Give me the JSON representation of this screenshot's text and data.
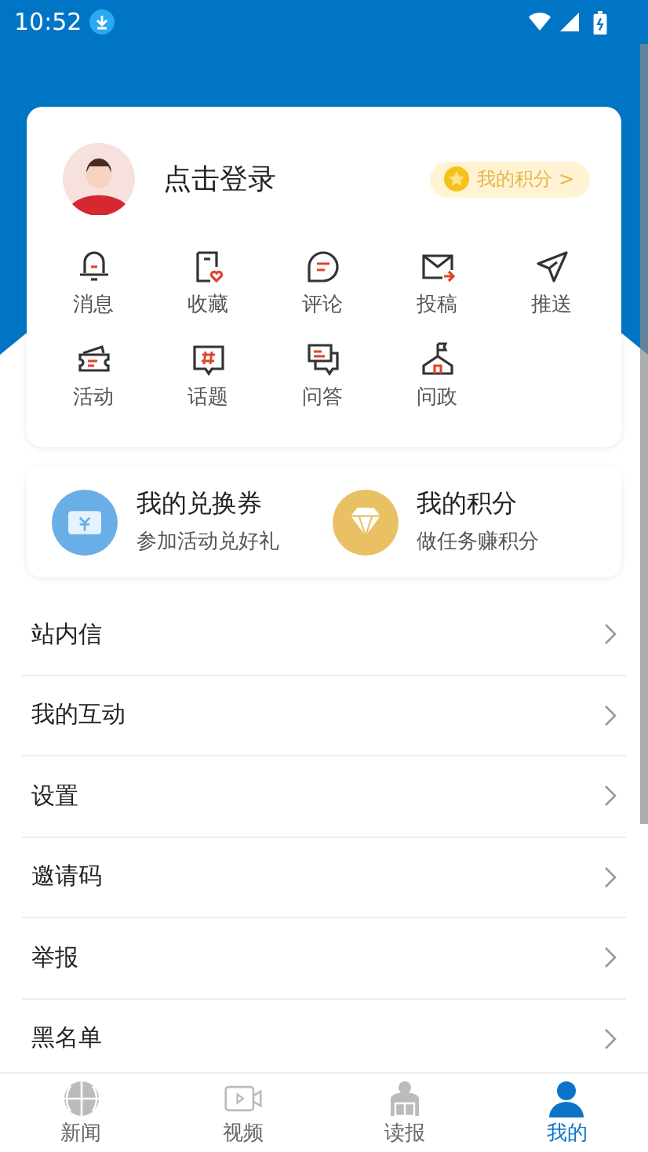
{
  "status_bar": {
    "time": "10:52"
  },
  "profile": {
    "login_label": "点击登录",
    "points_badge": "我的积分 >"
  },
  "shortcuts": [
    {
      "label": "消息"
    },
    {
      "label": "收藏"
    },
    {
      "label": "评论"
    },
    {
      "label": "投稿"
    },
    {
      "label": "推送"
    },
    {
      "label": "活动"
    },
    {
      "label": "话题"
    },
    {
      "label": "问答"
    },
    {
      "label": "问政"
    }
  ],
  "rewards": [
    {
      "kind": "coupon",
      "title": "我的兑换券",
      "subtitle": "参加活动兑好礼"
    },
    {
      "kind": "points",
      "title": "我的积分",
      "subtitle": "做任务赚积分"
    }
  ],
  "menu": [
    {
      "label": "站内信"
    },
    {
      "label": "我的互动"
    },
    {
      "label": "设置"
    },
    {
      "label": "邀请码"
    },
    {
      "label": "举报"
    },
    {
      "label": "黑名单"
    }
  ],
  "tabs": [
    {
      "kind": "news",
      "label": "新闻",
      "selected": false
    },
    {
      "kind": "video",
      "label": "视频",
      "selected": false
    },
    {
      "kind": "reader",
      "label": "读报",
      "selected": false
    },
    {
      "kind": "me",
      "label": "我的",
      "selected": true
    }
  ]
}
